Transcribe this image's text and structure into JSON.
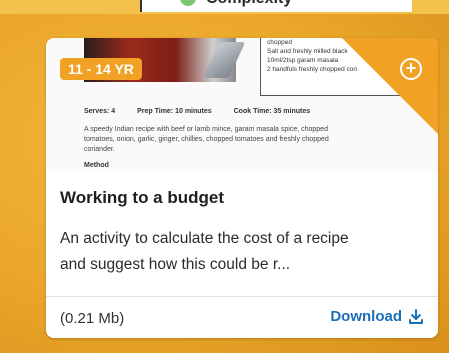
{
  "tag": {
    "label": "Complexity"
  },
  "card": {
    "age_badge": "11 - 14 YR",
    "thumbnail": {
      "ingredients": [
        "chopped",
        "Salt and freshly milled black",
        "10ml/2tsp garam masala",
        "2 handfuls freshly chopped cori"
      ],
      "serves": "Serves: 4",
      "prep_time": "Prep Time: 10 minutes",
      "cook_time": "Cook Time: 35 minutes",
      "description_lines": [
        "A speedy Indian recipe with beef or lamb mince, garam masala spice, chopped",
        "tomatoes, onion, garlic, ginger, chillies, chopped tomatoes and freshly chopped",
        "coriander."
      ],
      "method": "Method"
    },
    "add_icon": "plus-circle-icon",
    "title": "Working to a budget",
    "description_line1": "An activity to calculate the cost of a recipe",
    "description_line2": "and suggest how this could be r...",
    "file_size": "(0.21 Mb)",
    "download_label": "Download",
    "download_icon": "download-icon"
  },
  "colors": {
    "accent": "#f1a124",
    "link": "#1b6fb8",
    "background": "#e9a529"
  }
}
